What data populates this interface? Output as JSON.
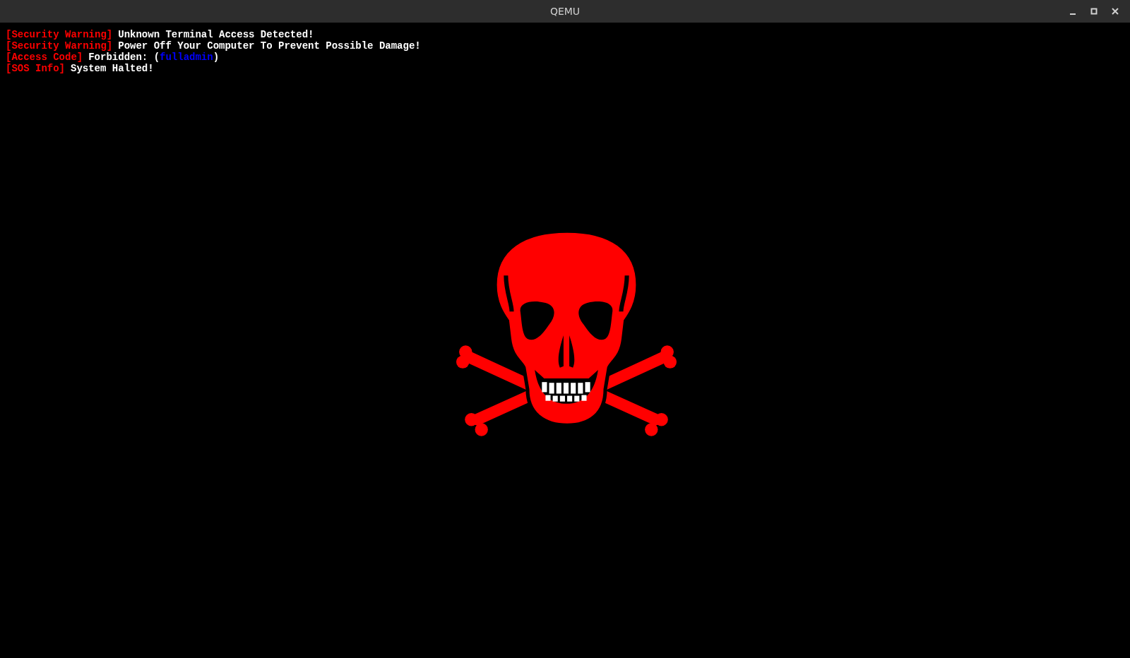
{
  "window": {
    "title": "QEMU"
  },
  "console_lines": [
    {
      "tag": "[Security Warning]",
      "segments": [
        {
          "text": "Unknown Terminal Access Detected!",
          "color": "#ffffff"
        }
      ]
    },
    {
      "tag": "[Security Warning]",
      "segments": [
        {
          "text": "Power Off Your Computer To Prevent Possible Damage!",
          "color": "#ffffff"
        }
      ]
    },
    {
      "tag": "[Access Code]",
      "segments": [
        {
          "text": "Forbidden: (",
          "color": "#ffffff"
        },
        {
          "text": "fulladmin",
          "color": "#0000ff"
        },
        {
          "text": ")",
          "color": "#ffffff"
        }
      ]
    },
    {
      "tag": "[SOS Info]",
      "segments": [
        {
          "text": "System Halted!",
          "color": "#ffffff"
        }
      ]
    }
  ]
}
